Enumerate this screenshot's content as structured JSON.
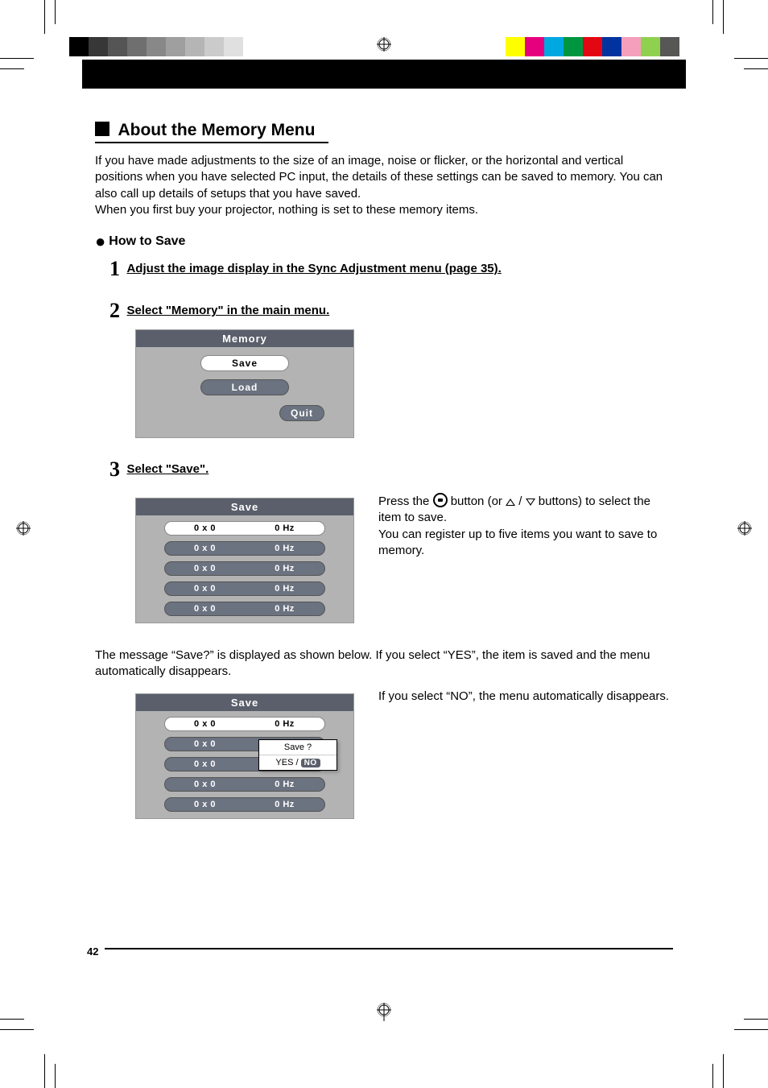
{
  "page_number": "42",
  "section_title": "About the Memory Menu",
  "intro_p1": "If you have made adjustments to the size of an image, noise or flicker, or the horizontal and vertical positions when you have selected PC input, the details of these settings can be saved to memory. You can also call up details of setups that you have saved.",
  "intro_p2": "When you first buy your projector, nothing is set to these memory items.",
  "sub_title": "How to Save",
  "steps": {
    "s1_num": "1",
    "s1_text": "Adjust the image display in the Sync Adjustment menu (page 35).",
    "s2_num": "2",
    "s2_text": "Select \"Memory\" in the main menu.",
    "s3_num": "3",
    "s3_text": "Select \"Save\"."
  },
  "memory_panel": {
    "title": "Memory",
    "items": [
      "Save",
      "Load",
      "Quit"
    ]
  },
  "save_panel": {
    "title": "Save",
    "rows": [
      {
        "res": "0 x 0",
        "hz": "0 Hz"
      },
      {
        "res": "0 x 0",
        "hz": "0 Hz"
      },
      {
        "res": "0 x 0",
        "hz": "0 Hz"
      },
      {
        "res": "0 x 0",
        "hz": "0 Hz"
      },
      {
        "res": "0 x 0",
        "hz": "0 Hz"
      }
    ]
  },
  "step3_side": {
    "line1a": "Press the ",
    "line1b": " button (or ",
    "line1c": " buttons) to select the item to save.",
    "line2": "You can register up to five items you want to save to memory."
  },
  "msg_text": "The message “Save?” is displayed as shown below. If you select “YES”, the item is saved and the menu automatically disappears.",
  "save_panel2_side": "If you select “NO”, the menu automatically disappears.",
  "popup": {
    "line1": "Save ?",
    "yes": "YES",
    "slash": " / ",
    "no": "NO"
  },
  "color_bars_left": [
    "#000000",
    "#373737",
    "#555555",
    "#6f6f6f",
    "#888888",
    "#9f9f9f",
    "#b5b5b5",
    "#cbcbcb",
    "#e0e0e0",
    "#ffffff"
  ],
  "color_bars_right": [
    "#ffffff",
    "#ffff00",
    "#e6007e",
    "#00a8e1",
    "#009640",
    "#e30613",
    "#0033a0",
    "#f59fbc",
    "#8fd14f",
    "#575756"
  ]
}
